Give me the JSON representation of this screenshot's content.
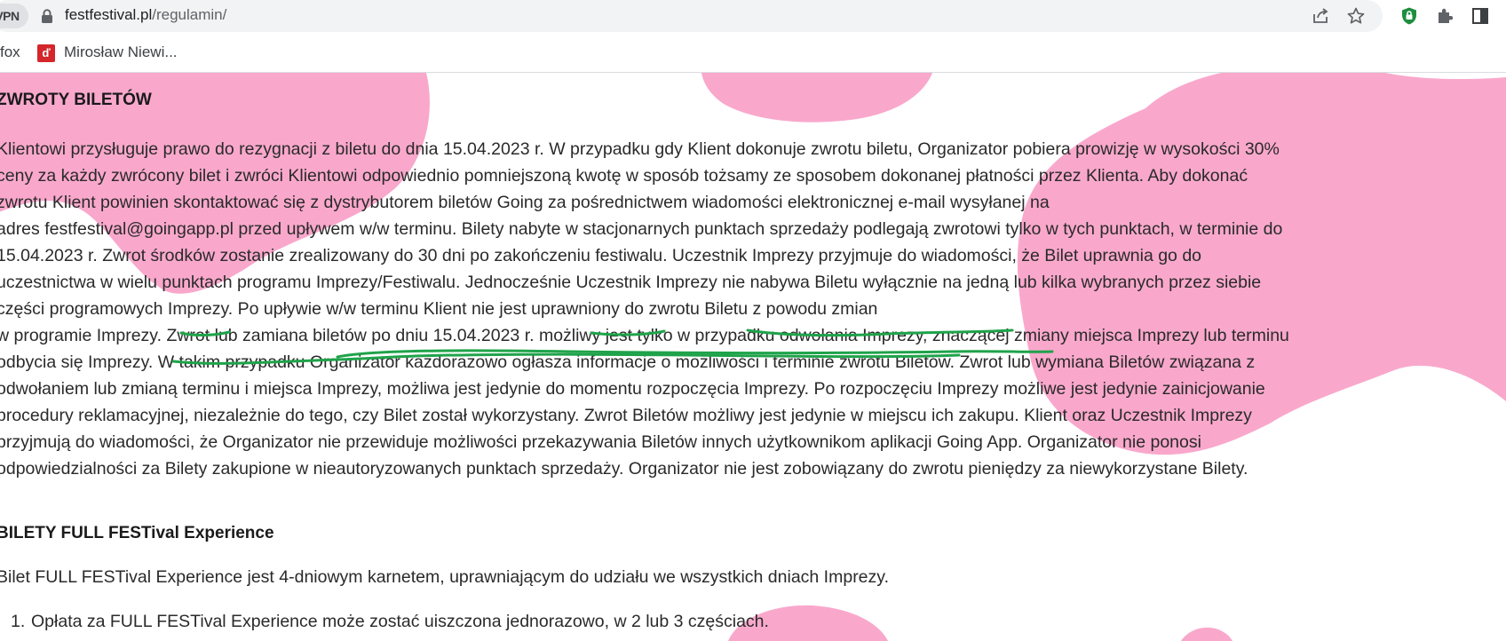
{
  "browser": {
    "vpn_label": "VPN",
    "url_domain": "festfestival.pl",
    "url_path": "/regulamin/",
    "bookmarks": [
      {
        "label": "fox"
      },
      {
        "label": "Mirosław Niewi..."
      }
    ]
  },
  "page": {
    "section1_heading": "ZWROTY BILETÓW",
    "section1_lines": [
      "Klientowi przysługuje prawo do rezygnacji z biletu do dnia 15.04.2023 r. W przypadku gdy Klient dokonuje zwrotu biletu, Organizator pobiera prowizję w wysokości 30%",
      "ceny za każdy zwrócony bilet i zwróci Klientowi odpowiednio pomniejszoną kwotę w sposób tożsamy ze sposobem dokonanej płatności przez Klienta. Aby dokonać",
      "zwrotu Klient powinien skontaktować się z dystrybutorem biletów Going za pośrednictwem wiadomości elektronicznej e-mail wysyłanej na",
      "adres festfestival@goingapp.pl przed upływem w/w terminu. Bilety nabyte w stacjonarnych punktach sprzedaży podlegają zwrotowi tylko w tych punktach, w terminie do",
      "15.04.2023 r. Zwrot środków zostanie zrealizowany do 30 dni po zakończeniu festiwalu. Uczestnik Imprezy przyjmuje do wiadomości, że Bilet uprawnia go do",
      "uczestnictwa w wielu punktach programu Imprezy/Festiwalu. Jednocześnie Uczestnik Imprezy nie nabywa Biletu wyłącznie na jedną lub kilka wybranych przez siebie",
      "części programowych Imprezy. Po upływie w/w terminu Klient nie jest uprawniony do zwrotu Biletu z powodu zmian",
      "w programie Imprezy. Zwrot lub zamiana biletów po dniu 15.04.2023 r. możliwy jest tylko w przypadku odwołania Imprezy, znaczącej zmiany miejsca Imprezy lub terminu",
      "odbycia się Imprezy. W takim przypadku Organizator każdorazowo ogłasza informacje o możliwości i terminie zwrotu Biletów. Zwrot lub wymiana Biletów związana z",
      "odwołaniem lub zmianą terminu i miejsca Imprezy, możliwa jest jedynie do momentu rozpoczęcia Imprezy. Po rozpoczęciu Imprezy możliwe jest jedynie zainicjowanie",
      "procedury reklamacyjnej, niezależnie do tego, czy Bilet został wykorzystany. Zwrot Biletów możliwy jest jedynie w miejscu ich zakupu. Klient oraz Uczestnik Imprezy",
      "przyjmują do wiadomości, że Organizator nie przewiduje możliwości przekazywania Biletów innych użytkownikom aplikacji Going App. Organizator nie ponosi",
      "odpowiedzialności za Bilety zakupione w nieautoryzowanych punktach sprzedaży. Organizator nie jest zobowiązany do zwrotu pieniędzy za niewykorzystane Bilety."
    ],
    "section2_heading": "BILETY FULL FESTival Experience",
    "section2_intro": "Bilet FULL FESTival Experience jest 4-dniowym karnetem, uprawniającym do udziału we wszystkich dniach Imprezy.",
    "list_item_1_number": "1.",
    "list_item_1_text": "Opłata za FULL FESTival Experience może zostać uiszczona jednorazowo, w 2 lub 3 częściach."
  },
  "colors": {
    "blob_pink": "#f9a8cc",
    "annotation_green": "#1fa34a",
    "chrome_bg": "#f1f3f4",
    "shield_green": "#1e8e3e"
  }
}
